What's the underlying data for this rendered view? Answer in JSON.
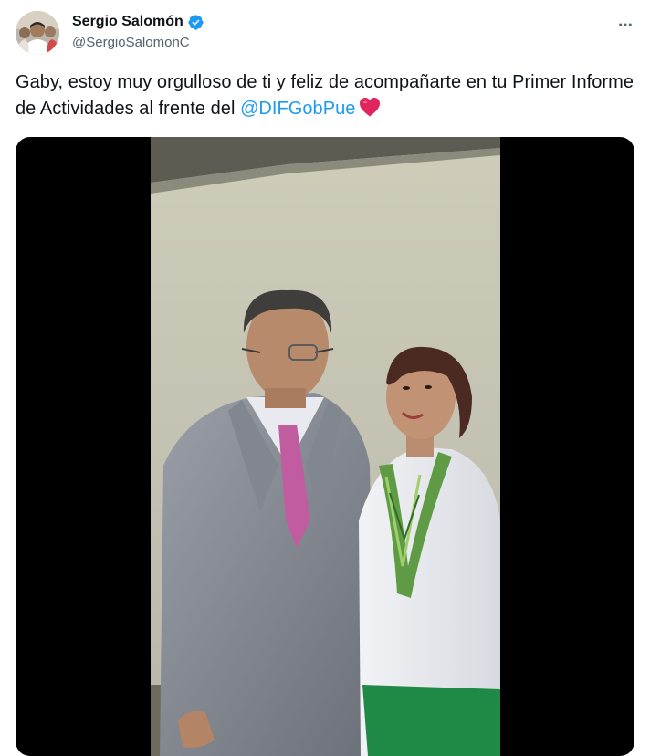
{
  "author": {
    "display_name": "Sergio Salomón",
    "handle": "@SergioSalomonC",
    "verified": true,
    "verified_icon": "verified-badge-icon",
    "avatar": "profile-photo"
  },
  "menu_icon": "more-options-icon",
  "tweet": {
    "text_part1": "Gaby, estoy muy orgulloso de ti y feliz de acompañarte en tu Primer Informe de Actividades al frente del ",
    "mention": "@DIFGobPue",
    "emoji": "red-heart-icon"
  },
  "media": {
    "type": "video",
    "subject": "video-still"
  },
  "colors": {
    "accent": "#1d9bf0",
    "heart": "#f91880",
    "text": "#0f1419",
    "secondary": "#536471"
  }
}
